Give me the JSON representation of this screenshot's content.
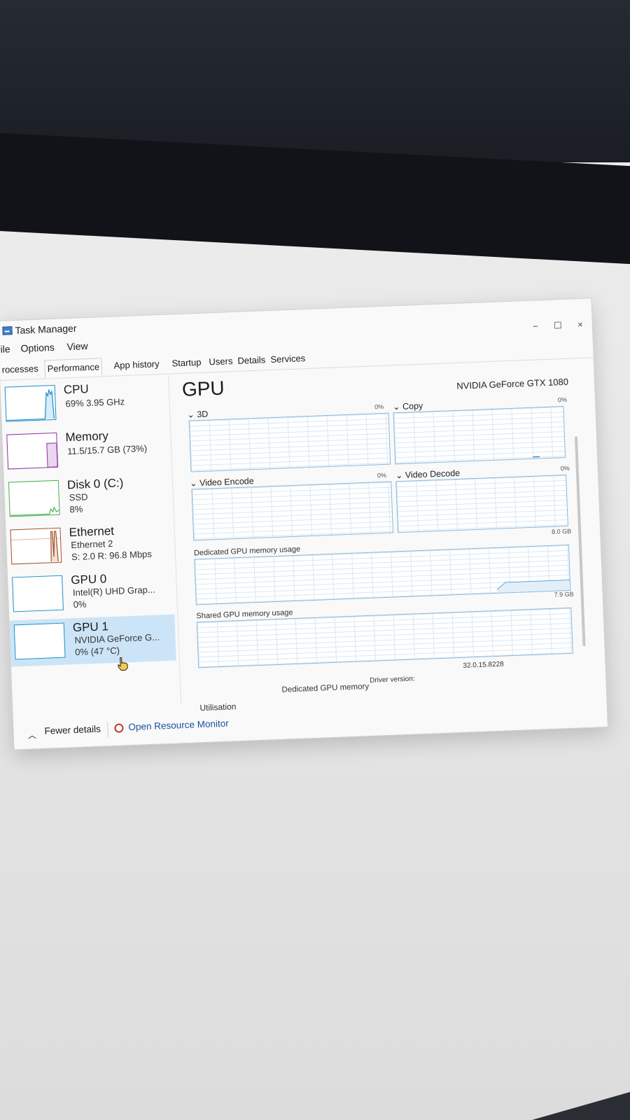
{
  "window": {
    "title": "Task Manager",
    "controls": {
      "minimize": "−",
      "maximize": "☐",
      "close": "×"
    }
  },
  "menu": [
    "ile",
    "Options",
    "View"
  ],
  "tabs": [
    "rocesses",
    "Performance",
    "App history",
    "Startup",
    "Users",
    "Details",
    "Services"
  ],
  "active_tab": "Performance",
  "sidebar": {
    "items": [
      {
        "name": "CPU",
        "lines": [
          "69% 3.95 GHz"
        ],
        "color": "#1a8fc6"
      },
      {
        "name": "Memory",
        "lines": [
          "11.5/15.7 GB (73%)"
        ],
        "color": "#8b2f9f"
      },
      {
        "name": "Disk 0 (C:)",
        "lines": [
          "SSD",
          "8%"
        ],
        "color": "#4caf50"
      },
      {
        "name": "Ethernet",
        "lines": [
          "Ethernet 2",
          "S: 2.0  R: 96.8 Mbps"
        ],
        "color": "#a0522d"
      },
      {
        "name": "GPU 0",
        "lines": [
          "Intel(R) UHD Grap...",
          "0%"
        ],
        "color": "#1a8fc6"
      },
      {
        "name": "GPU 1",
        "lines": [
          "NVIDIA GeForce G...",
          "0% (47 °C)"
        ],
        "color": "#1a8fc6"
      }
    ],
    "selected_index": 5
  },
  "main": {
    "heading": "GPU",
    "gpu_name": "NVIDIA GeForce GTX 1080",
    "engines": [
      {
        "label": "3D",
        "pct": "0%"
      },
      {
        "label": "Copy",
        "pct": "0%"
      },
      {
        "label": "Video Encode",
        "pct": "0%"
      },
      {
        "label": "Video Decode",
        "pct": "0%"
      }
    ],
    "dedicated": {
      "label": "Dedicated GPU memory usage",
      "max": "8.0 GB"
    },
    "shared": {
      "label": "Shared GPU memory usage",
      "max": "7.9 GB"
    },
    "stats": {
      "utilisation_label": "Utilisation",
      "dedicated_label": "Dedicated GPU memory",
      "driver_label": "Driver version:",
      "driver_value": "32.0.15.8228"
    }
  },
  "footer": {
    "fewer_details": "Fewer details",
    "open_resource_monitor": "Open Resource Monitor"
  }
}
